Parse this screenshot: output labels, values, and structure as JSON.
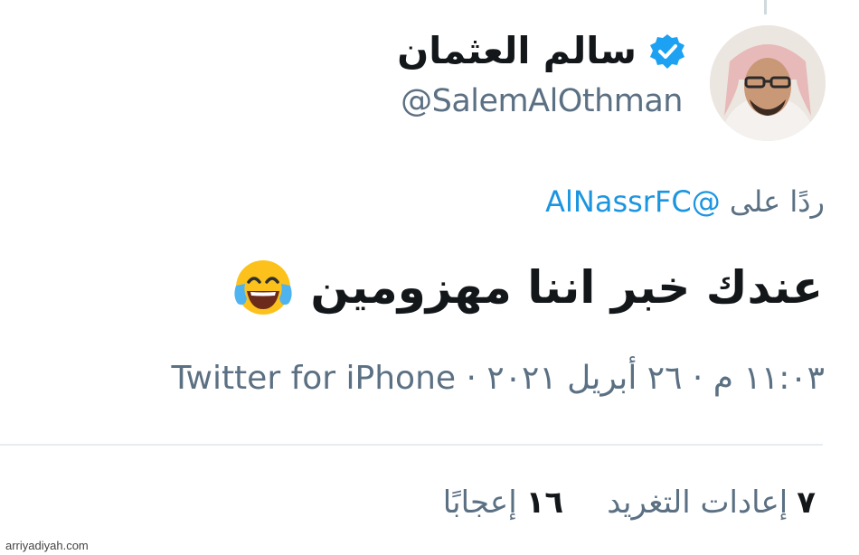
{
  "tweet": {
    "author": {
      "display_name": "سالم العثمان",
      "handle": "@SalemAlOthman",
      "verified": true
    },
    "reply": {
      "prefix": "ردًا على",
      "mention": "@AlNassrFC"
    },
    "text": "عندك خبر اننا مهزومين",
    "emoji_icon": "face-with-tears-of-joy-icon",
    "meta": "١١:٠٣ م · ٢٦ أبريل ٢٠٢١ · Twitter for iPhone",
    "stats": {
      "retweets_count": "٧",
      "retweets_label": "إعادات التغريد",
      "likes_count": "١٦",
      "likes_label": "إعجابًا"
    }
  },
  "watermark": "arriyadiyah.com",
  "colors": {
    "link": "#1b95e0",
    "secondary_text": "#5b7083",
    "primary_text": "#14171a",
    "verified_badge": "#1da1f2"
  }
}
